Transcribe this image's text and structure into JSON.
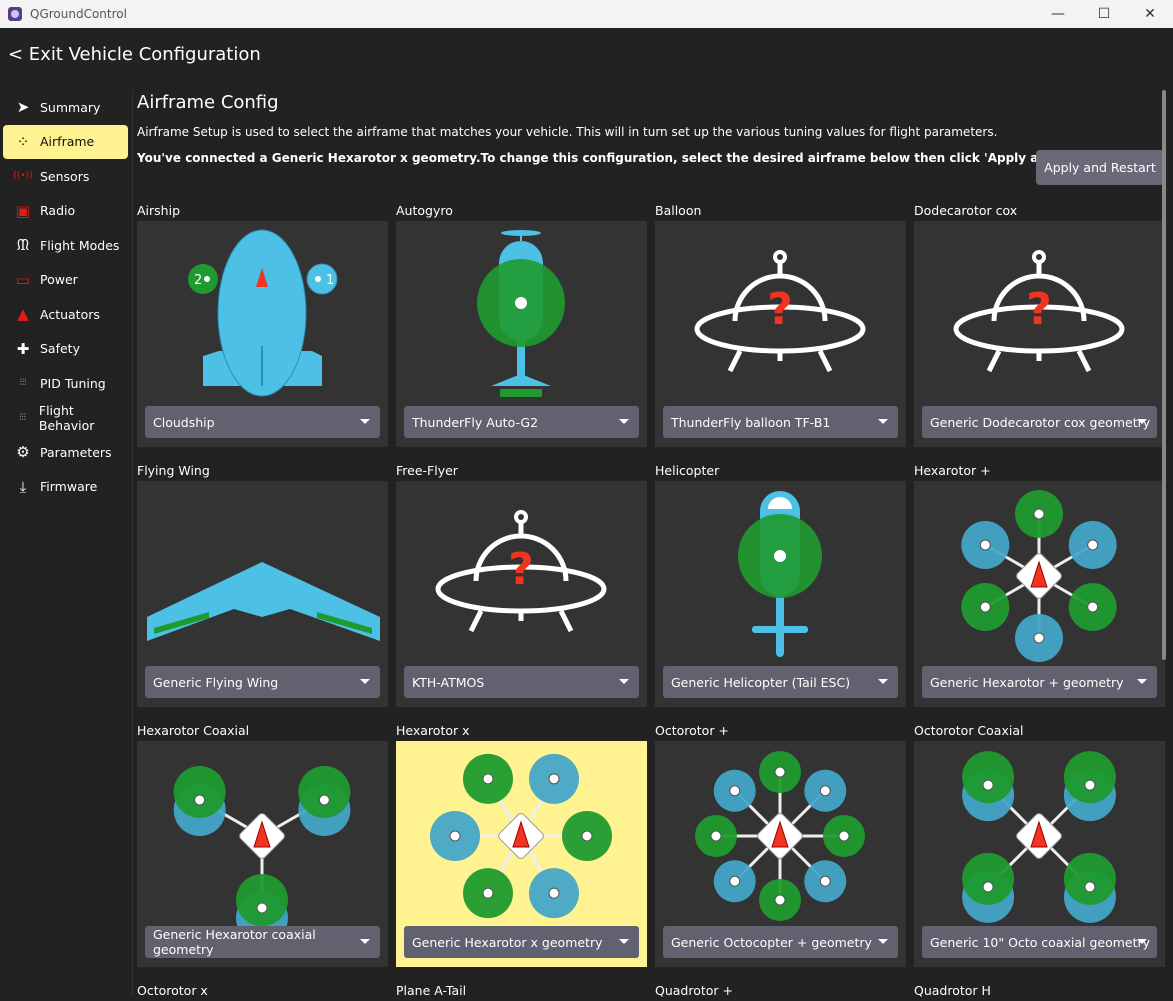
{
  "window": {
    "title": "QGroundControl",
    "minimize": "—",
    "maximize": "☐",
    "close": "✕"
  },
  "header": {
    "exit_label": "<  Exit Vehicle Configuration"
  },
  "sidebar": {
    "items": [
      {
        "label": "Summary",
        "icon": "paper-plane-icon",
        "glyph": "➤",
        "color": "#ffffff"
      },
      {
        "label": "Airframe",
        "icon": "airframe-icon",
        "glyph": "⁘",
        "color": "#111111",
        "selected": true
      },
      {
        "label": "Sensors",
        "icon": "sensors-icon",
        "glyph": "((•))",
        "color": "#e41b1b"
      },
      {
        "label": "Radio",
        "icon": "radio-icon",
        "glyph": "▣",
        "color": "#e41b1b"
      },
      {
        "label": "Flight Modes",
        "icon": "flight-modes-icon",
        "glyph": "ᙢ",
        "color": "#ffffff"
      },
      {
        "label": "Power",
        "icon": "battery-icon",
        "glyph": "▭",
        "color": "#e41b1b"
      },
      {
        "label": "Actuators",
        "icon": "actuators-icon",
        "glyph": "▲",
        "color": "#e41b1b"
      },
      {
        "label": "Safety",
        "icon": "first-aid-icon",
        "glyph": "✚",
        "color": "#ffffff"
      },
      {
        "label": "PID Tuning",
        "icon": "sliders-icon",
        "glyph": "⫶⫶⫶",
        "color": "#ffffff"
      },
      {
        "label": "Flight Behavior",
        "icon": "sliders-icon",
        "glyph": "⫶⫶⫶",
        "color": "#ffffff"
      },
      {
        "label": "Parameters",
        "icon": "gears-icon",
        "glyph": "⚙",
        "color": "#ffffff"
      },
      {
        "label": "Firmware",
        "icon": "download-icon",
        "glyph": "⤓",
        "color": "#ffffff"
      }
    ]
  },
  "main": {
    "title": "Airframe Config",
    "description": "Airframe Setup is used to select the airframe that matches your vehicle. This will in turn set up the various tuning values for flight parameters.",
    "connected": "You've connected a Generic Hexarotor x geometry.To change this configuration, select the desired airframe below then click 'Apply and Restart'.",
    "apply_label": "Apply and Restart",
    "airframes": [
      {
        "label": "Airship",
        "selected_value": "Cloudship",
        "icon": "airship"
      },
      {
        "label": "Autogyro",
        "selected_value": "ThunderFly Auto-G2",
        "icon": "autogyro"
      },
      {
        "label": "Balloon",
        "selected_value": "ThunderFly balloon TF-B1",
        "icon": "unknown"
      },
      {
        "label": "Dodecarotor cox",
        "selected_value": "Generic Dodecarotor cox geometry",
        "icon": "unknown"
      },
      {
        "label": "Flying Wing",
        "selected_value": "Generic Flying Wing",
        "icon": "flying-wing"
      },
      {
        "label": "Free-Flyer",
        "selected_value": "KTH-ATMOS",
        "icon": "unknown"
      },
      {
        "label": "Helicopter",
        "selected_value": "Generic Helicopter (Tail ESC)",
        "icon": "helicopter"
      },
      {
        "label": "Hexarotor +",
        "selected_value": "Generic Hexarotor + geometry",
        "icon": "hex-plus"
      },
      {
        "label": "Hexarotor Coaxial",
        "selected_value": "Generic Hexarotor coaxial geometry",
        "icon": "hex-coax"
      },
      {
        "label": "Hexarotor x",
        "selected_value": "Generic Hexarotor x geometry",
        "icon": "hex-x",
        "selected": true
      },
      {
        "label": "Octorotor +",
        "selected_value": "Generic Octocopter + geometry",
        "icon": "octo-plus"
      },
      {
        "label": "Octorotor Coaxial",
        "selected_value": "Generic 10\" Octo coaxial geometry",
        "icon": "octo-coax"
      },
      {
        "label": "Octorotor x",
        "icon": "octo-x"
      },
      {
        "label": "Plane A-Tail",
        "icon": "plane"
      },
      {
        "label": "Quadrotor +",
        "icon": "quad-plus"
      },
      {
        "label": "Quadrotor H",
        "icon": "quad-h"
      }
    ]
  },
  "colors": {
    "selected": "#fff291",
    "green": "#1f9a2f",
    "blue": "#45a5c8",
    "airship": "#4dc0e6",
    "red": "#f0341f"
  }
}
